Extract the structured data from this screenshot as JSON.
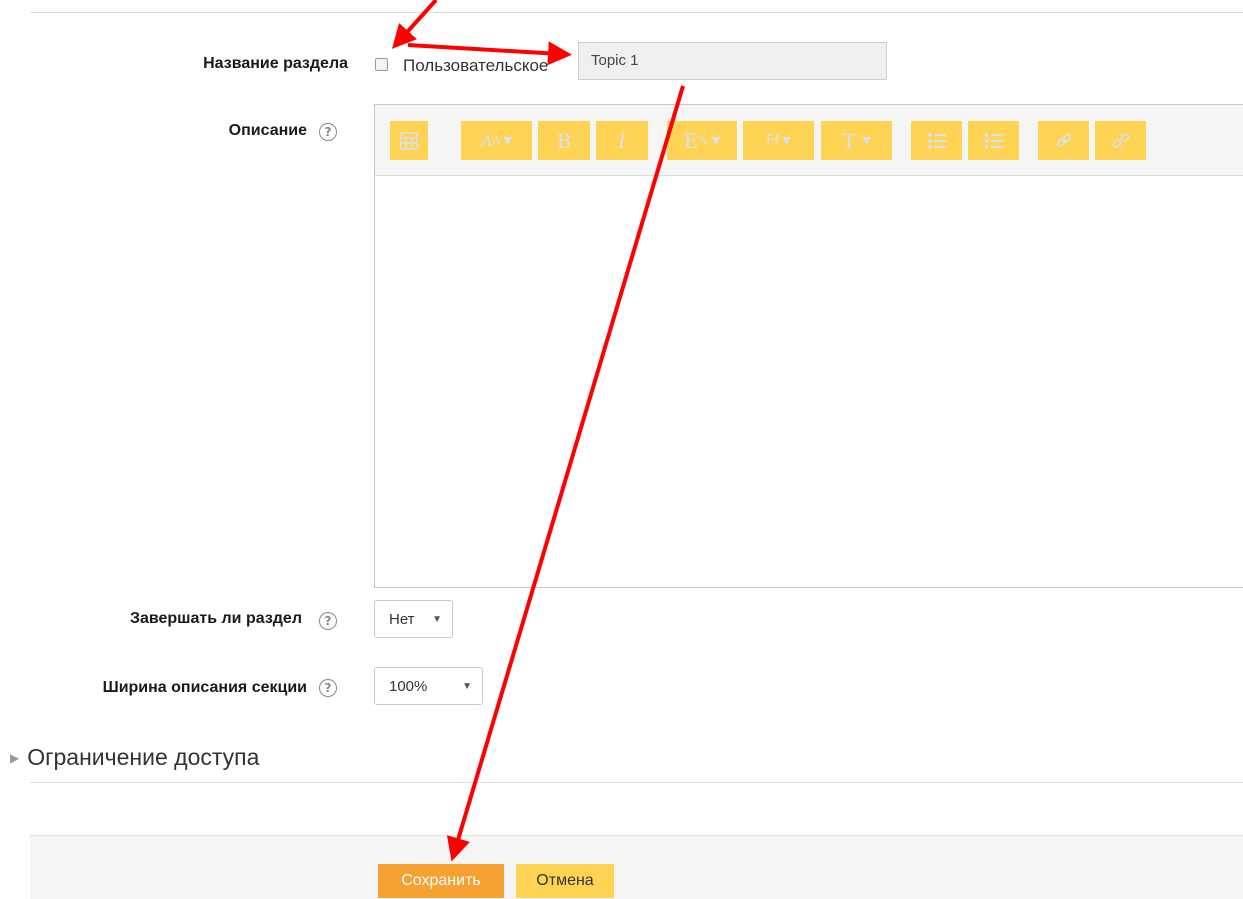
{
  "form": {
    "section_name": {
      "label": "Название раздела",
      "custom_checkbox_label": "Пользовательское",
      "input_value": "Topic 1"
    },
    "description": {
      "label": "Описание",
      "toolbar_icons": [
        "insert-table-icon",
        "font-size-icon",
        "bold-icon",
        "italic-icon",
        "text-color-icon",
        "font-family-icon",
        "paragraph-style-icon",
        "bullet-list-icon",
        "numbered-list-icon",
        "link-icon",
        "unlink-icon"
      ],
      "bold_glyph": "B",
      "italic_glyph": "I"
    },
    "complete_section": {
      "label": "Завершать ли раздел",
      "selected": "Нет"
    },
    "section_width": {
      "label": "Ширина описания секции",
      "selected": "100%"
    }
  },
  "access_section": {
    "title": "Ограничение доступа"
  },
  "buttons": {
    "save": "Сохранить",
    "cancel": "Отмена"
  },
  "colors": {
    "toolbar_button": "#ffd455",
    "save_button": "#f7a133",
    "annotation_arrow": "#ff0000"
  }
}
